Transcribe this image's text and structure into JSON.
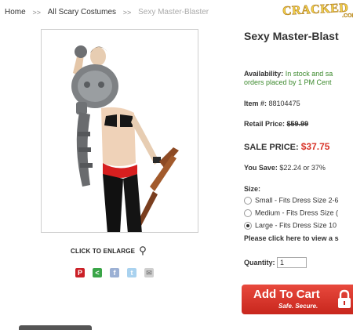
{
  "breadcrumb": {
    "home": "Home",
    "sep1": ">>",
    "category": "All Scary Costumes",
    "sep2": ">>",
    "current": "Sexy Master-Blaster"
  },
  "logo": {
    "text": "CRACKED.COM"
  },
  "product": {
    "title": "Sexy Master-Blast",
    "availability_label": "Availability:",
    "availability_value": "In stock and sa",
    "availability_note": "orders placed by 1 PM Cent",
    "item_label": "Item #:",
    "item_value": "88104475",
    "retail_label": "Retail Price:",
    "retail_value": "$59.99",
    "sale_label": "SALE PRICE:",
    "sale_value": "$37.75",
    "save_label": "You Save:",
    "save_value": "$22.24 or 37%",
    "size_label": "Size:",
    "sizes": [
      {
        "label": "Small - Fits Dress Size 2-6",
        "checked": false
      },
      {
        "label": "Medium - Fits Dress Size (",
        "checked": false
      },
      {
        "label": "Large - Fits Dress Size 10",
        "checked": true
      }
    ],
    "size_chart_text": "Please click here to view a s",
    "quantity_label": "Quantity:",
    "quantity_value": "1"
  },
  "image": {
    "enlarge_label": "CLICK TO ENLARGE"
  },
  "share": {
    "icons": [
      {
        "name": "pinterest-icon",
        "glyph": "P",
        "color": "#cb2027"
      },
      {
        "name": "share-icon",
        "glyph": "<",
        "color": "#3aa548"
      },
      {
        "name": "facebook-icon",
        "glyph": "f",
        "color": "#9bb0d4"
      },
      {
        "name": "twitter-icon",
        "glyph": "t",
        "color": "#a9d2ef"
      },
      {
        "name": "email-icon",
        "glyph": "✉",
        "color": "#cfcfcf"
      }
    ]
  },
  "cart": {
    "button_label": "Add To Cart",
    "sub_label": "Safe. Secure."
  }
}
